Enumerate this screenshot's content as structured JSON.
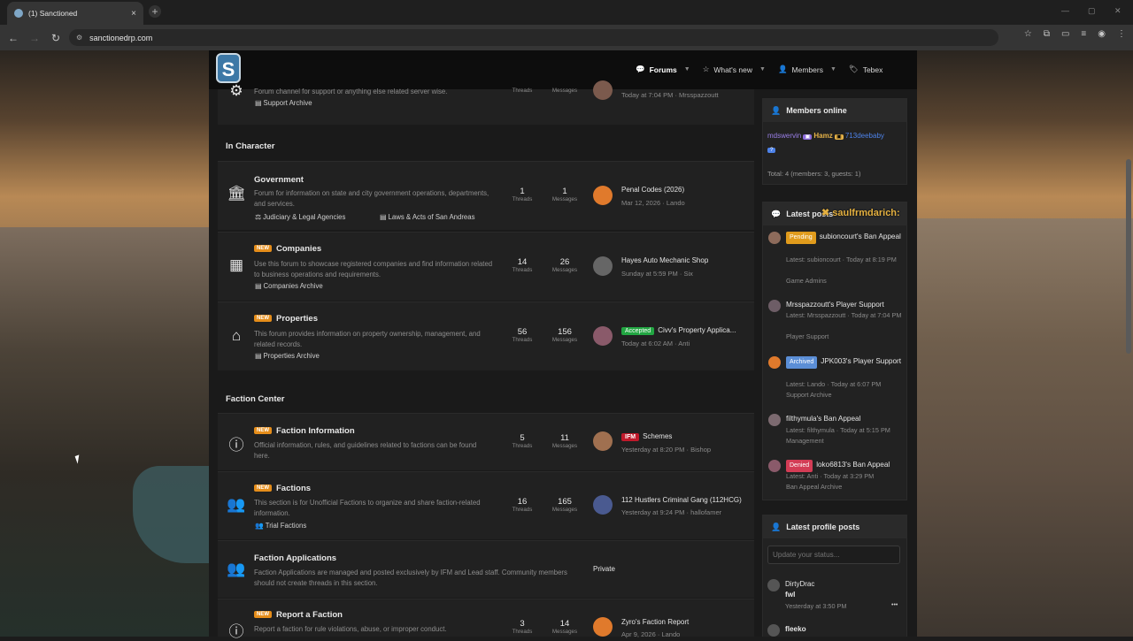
{
  "browser": {
    "tab_title": "(1) Sanctioned",
    "tab_close": "×",
    "new_tab": "+",
    "url": "sanctionedrp.com",
    "window_controls": [
      "—",
      "▢",
      "✕"
    ]
  },
  "site": {
    "logo_letter": "S",
    "nav": [
      {
        "label": "Forums",
        "icon": "comments-icon"
      },
      {
        "label": "What's new",
        "icon": "star-icon"
      },
      {
        "label": "Members",
        "icon": "user-icon"
      },
      {
        "label": "Tebex",
        "icon": "tag-icon"
      }
    ]
  },
  "partial_node": {
    "desc": "Forum channel for support or anything else related server wise.",
    "sub": "Support Archive",
    "threads_label": "Threads",
    "messages_label": "Messages",
    "lp_meta": "Today at 7:04 PM · Mrsspazzoutt"
  },
  "categories": [
    {
      "title": "In Character",
      "nodes": [
        {
          "title": "Government",
          "new": false,
          "desc": "Forum for information on state and city government operations, departments, and services.",
          "subs": [
            "Judiciary & Legal Agencies",
            "Laws & Acts of San Andreas"
          ],
          "threads": "1",
          "messages": "1",
          "lp_title": "Penal Codes (2026)",
          "lp_prefix": "",
          "lp_meta": "Mar 12, 2026 · Lando"
        },
        {
          "title": "Companies",
          "new": true,
          "desc": "Use this forum to showcase registered companies and find information related to business operations and requirements.",
          "subs": [
            "Companies Archive"
          ],
          "threads": "14",
          "messages": "26",
          "lp_title": "Hayes Auto Mechanic Shop",
          "lp_prefix": "",
          "lp_meta": "Sunday at 5:59 PM · Six"
        },
        {
          "title": "Properties",
          "new": true,
          "desc": "This forum provides information on property ownership, management, and related records.",
          "subs": [
            "Properties Archive"
          ],
          "threads": "56",
          "messages": "156",
          "lp_title": "Civv's Property Applica...",
          "lp_prefix": "Accepted",
          "lp_meta": "Today at 6:02 AM · Anti"
        }
      ]
    },
    {
      "title": "Faction Center",
      "nodes": [
        {
          "title": "Faction Information",
          "new": true,
          "desc": "Official information, rules, and guidelines related to factions can be found here.",
          "subs": [],
          "threads": "5",
          "messages": "11",
          "lp_title": "Schemes",
          "lp_prefix": "IFM",
          "lp_meta": "Yesterday at 8:20 PM · Bishop"
        },
        {
          "title": "Factions",
          "new": true,
          "desc": "This section is for Unofficial Factions to organize and share faction-related information.",
          "subs": [
            "Trial Factions"
          ],
          "threads": "16",
          "messages": "165",
          "lp_title": "112 Hustlers Criminal Gang (112HCG)",
          "lp_prefix": "",
          "lp_meta": "Yesterday at 9:24 PM · hallofamer"
        },
        {
          "title": "Faction Applications",
          "new": false,
          "desc": "Faction Applications are managed and posted exclusively by IFM and Lead staff. Community members should not create threads in this section.",
          "subs": [],
          "private": "Private"
        },
        {
          "title": "Report a Faction",
          "new": true,
          "desc": "Report a faction for rule violations, abuse, or improper conduct.",
          "subs": [],
          "threads": "3",
          "messages": "14",
          "lp_title": "Zyro's Faction Report",
          "lp_prefix": "",
          "lp_meta": "Apr 9, 2026 · Lando"
        }
      ]
    }
  ],
  "labels": {
    "threads": "Threads",
    "messages": "Messages",
    "new": "NEW"
  },
  "sidebar": {
    "members_online": {
      "title": "Members online",
      "names": [
        "mdswervin",
        "Hamz",
        "713deebaby"
      ],
      "total": "Total: 4 (members: 3, guests: 1)"
    },
    "latest_posts": {
      "title": "Latest posts",
      "overlay_name": "saulfrmdarich:",
      "items": [
        {
          "prefix": "Pending",
          "title": "subioncourt's Ban Appeal",
          "meta": "Latest: subioncourt · Today at 8:19 PM",
          "forum": "Game Admins"
        },
        {
          "prefix": "",
          "title": "Mrsspazzoutt's Player Support",
          "meta": "Latest: Mrsspazzoutt · Today at 7:04 PM",
          "forum": "Player Support"
        },
        {
          "prefix": "Archived",
          "title": "JPK003's Player Support",
          "meta": "Latest: Lando · Today at 6:07 PM",
          "forum": "Support Archive"
        },
        {
          "prefix": "",
          "title": "filthymula's Ban Appeal",
          "meta": "Latest: filthymula · Today at 5:15 PM",
          "forum": "Management"
        },
        {
          "prefix": "Denied",
          "title": "loko6813's Ban Appeal",
          "meta": "Latest: Anti · Today at 3:29 PM",
          "forum": "Ban Appeal Archive"
        }
      ]
    },
    "profile_posts": {
      "title": "Latest profile posts",
      "placeholder": "Update your status...",
      "posts": [
        {
          "user": "DirtyDrac",
          "text": "fwl",
          "time": "Yesterday at 3:50 PM",
          "more": "•••"
        },
        {
          "user": "fleeko",
          "text": "",
          "time": ""
        }
      ]
    }
  },
  "colors": {
    "accent_new": "#e58d1a",
    "accepted": "#22a642",
    "ifm": "#c0192b",
    "pending": "#e09b1c",
    "archived": "#5b8ed6",
    "denied": "#d33c55"
  }
}
